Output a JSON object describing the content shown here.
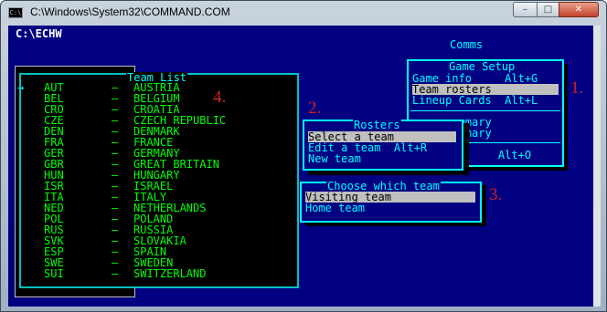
{
  "window": {
    "title": "C:\\Windows\\System32\\COMMAND.COM",
    "icon_label": "C:\\",
    "buttons": {
      "minimize": "–",
      "maximize": "□",
      "close": "✕"
    }
  },
  "console": {
    "prompt": "C:\\ECHW",
    "comms": "Comms"
  },
  "game_setup": {
    "title": "Game Setup",
    "items": [
      {
        "label": "Game info     Alt+G",
        "selected": false
      },
      {
        "label": "Team rosters",
        "selected": true
      },
      {
        "label": "Lineup Cards  Alt+L",
        "selected": false
      },
      {
        "label": "     summary",
        "selected": false
      },
      {
        "label": "     summary",
        "selected": false
      },
      {
        "label": "             Alt+O",
        "selected": false
      }
    ]
  },
  "rosters": {
    "title": "Rosters",
    "items": [
      {
        "label": "Select a team",
        "selected": true
      },
      {
        "label": "Edit a team  Alt+R",
        "selected": false
      },
      {
        "label": "New team",
        "selected": false
      }
    ]
  },
  "choose_team": {
    "title": "Choose which team",
    "items": [
      {
        "label": "Visiting team",
        "selected": true
      },
      {
        "label": "Home team",
        "selected": false
      }
    ]
  },
  "team_list": {
    "title": "Team List",
    "cursor": "→",
    "teams": [
      {
        "code": "AUT",
        "name": "AUSTRIA"
      },
      {
        "code": "BEL",
        "name": "BELGIUM"
      },
      {
        "code": "CRO",
        "name": "CROATIA"
      },
      {
        "code": "CZE",
        "name": "CZECH REPUBLIC"
      },
      {
        "code": "DEN",
        "name": "DENMARK"
      },
      {
        "code": "FRA",
        "name": "FRANCE"
      },
      {
        "code": "GER",
        "name": "GERMANY"
      },
      {
        "code": "GBR",
        "name": "GREAT BRITAIN"
      },
      {
        "code": "HUN",
        "name": "HUNGARY"
      },
      {
        "code": "ISR",
        "name": "ISRAEL"
      },
      {
        "code": "ITA",
        "name": "ITALY"
      },
      {
        "code": "NED",
        "name": "NETHERLANDS"
      },
      {
        "code": "POL",
        "name": "POLAND"
      },
      {
        "code": "RUS",
        "name": "RUSSIA"
      },
      {
        "code": "SVK",
        "name": "SLOVAKIA"
      },
      {
        "code": "ESP",
        "name": "SPAIN"
      },
      {
        "code": "SWE",
        "name": "SWEDEN"
      },
      {
        "code": "SUI",
        "name": "SWITZERLAND"
      }
    ],
    "dash": "–"
  },
  "markers": {
    "m1": "1.",
    "m2": "2.",
    "m3": "3.",
    "m4": "4."
  },
  "colors": {
    "console_bg": "#000080",
    "menu_fg": "#00ffff",
    "team_fg": "#00ff00",
    "highlight": "#c0c0c0",
    "marker": "#d42020"
  }
}
